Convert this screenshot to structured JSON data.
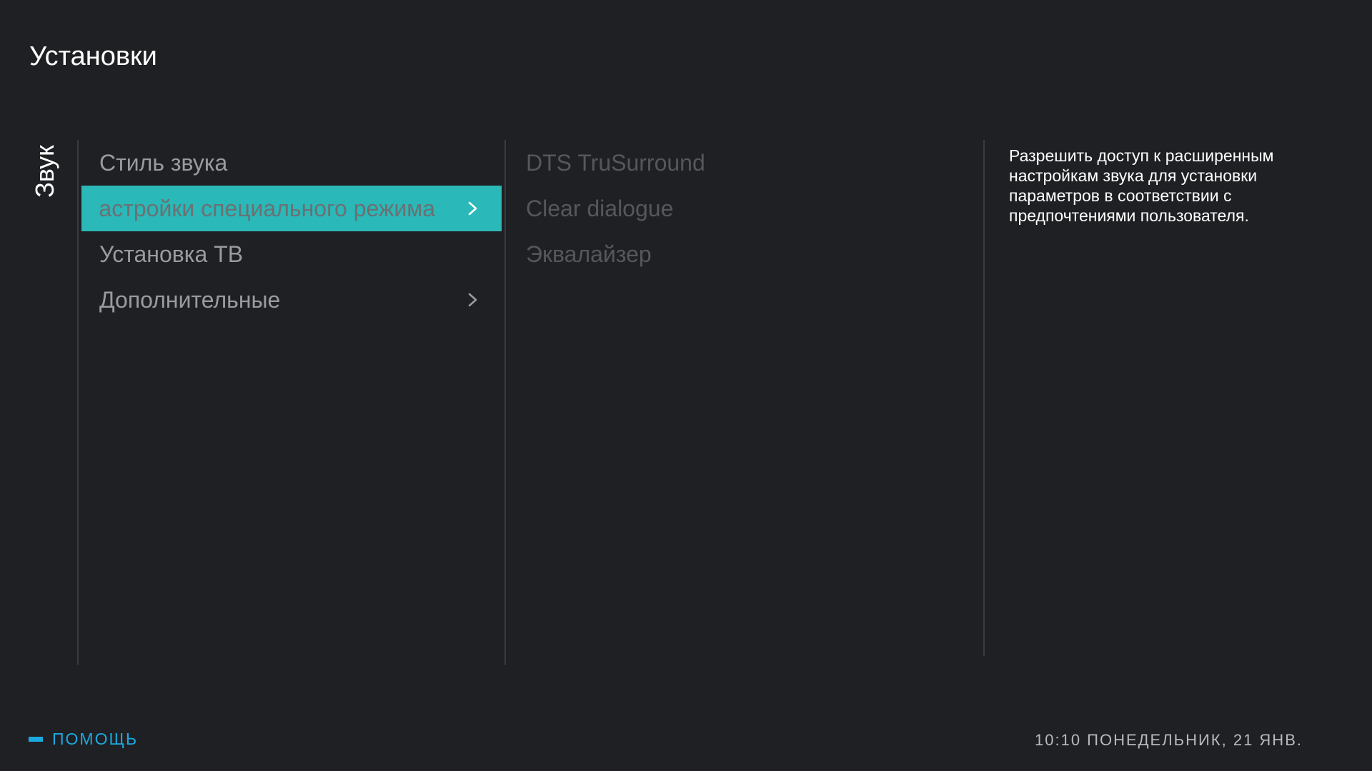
{
  "header": {
    "title": "Установки"
  },
  "section": {
    "label": "Звук"
  },
  "menu": {
    "items": [
      {
        "label": "Стиль звука"
      },
      {
        "label": "Настройки специального режима"
      },
      {
        "label": "Установка ТВ"
      },
      {
        "label": "Дополнительные"
      }
    ],
    "selected_index": 1
  },
  "submenu": {
    "items": [
      {
        "label": "DTS TruSurround"
      },
      {
        "label": "Clear dialogue"
      },
      {
        "label": "Эквалайзер"
      }
    ]
  },
  "description": {
    "text": "Разрешить доступ к расширенным настройкам звука для установки параметров в соответствии с предпочтениями пользователя."
  },
  "footer": {
    "help_label": "ПОМОЩЬ",
    "datetime": "10:10 ПОНЕДЕЛЬНИК, 21 ЯНВ."
  },
  "colors": {
    "background": "#1f2023",
    "accent_selected": "#2bb8b8",
    "help_accent": "#1ba9e0"
  },
  "icons": {
    "chevron": "chevron-right-icon",
    "help_marker": "help-key-icon"
  }
}
